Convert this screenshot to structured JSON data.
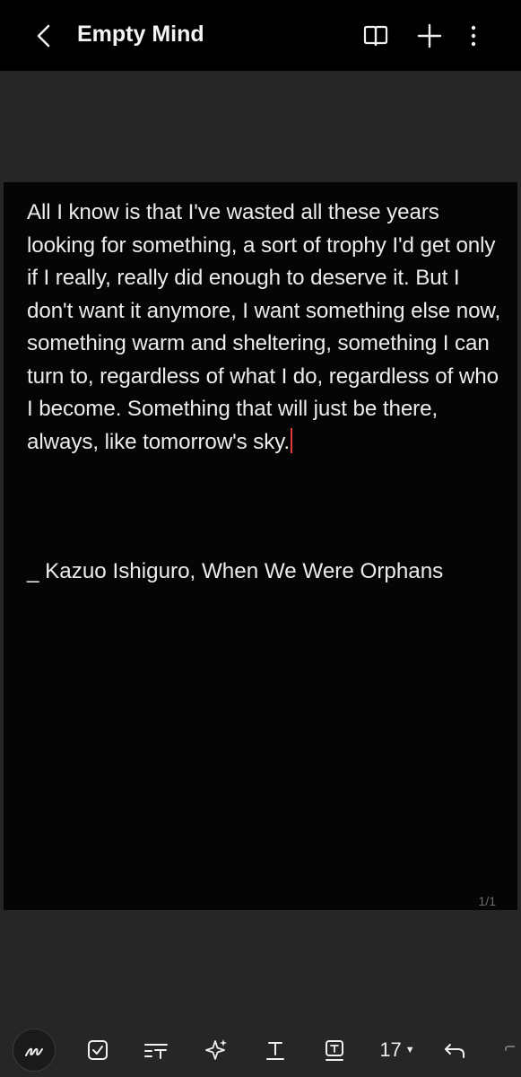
{
  "header": {
    "title": "Empty Mind",
    "icons": [
      "back-arrow-icon",
      "book-view-icon",
      "add-icon",
      "more-options-icon"
    ]
  },
  "note": {
    "body": "All I know is that I've wasted all these years looking for something, a sort of trophy I'd get only if I really, really did enough to deserve it. But I don't want it anymore, I want something else now, something warm and sheltering, something I can turn to, regardless of what I do, regardless of who I become. Something that will just be there, always, like tomorrow's sky.",
    "attribution": "_ Kazuo Ishiguro, When We Were Orphans",
    "page_indicator": "1/1"
  },
  "toolbar": {
    "font_size": "17",
    "icons": [
      "handwriting-icon",
      "checkbox-icon",
      "text-style-icon",
      "ai-sparkle-icon",
      "text-format-icon",
      "text-box-icon",
      "undo-icon",
      "redo-icon"
    ]
  },
  "colors": {
    "background": "#262626",
    "header": "#000000",
    "page": "#050505",
    "cursor": "#e53935"
  }
}
